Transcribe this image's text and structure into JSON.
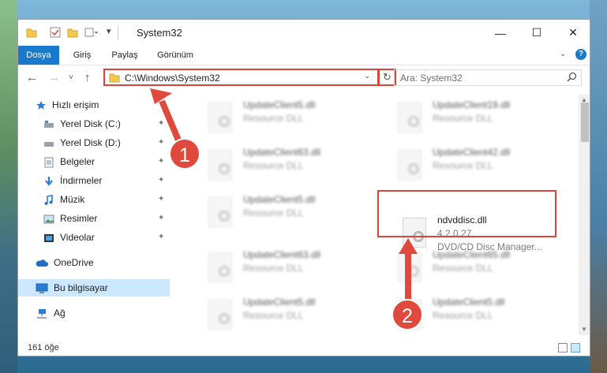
{
  "window": {
    "title": "System32",
    "controls": {
      "minimize": "—",
      "maximize": "☐",
      "close": "✕"
    }
  },
  "ribbon": {
    "tabs": [
      "Dosya",
      "Giriş",
      "Paylaş",
      "Görünüm"
    ],
    "active_tab": "Dosya",
    "expand_icon": "chevron-down-icon",
    "help_icon": "?"
  },
  "nav": {
    "address": "C:\\Windows\\System32",
    "search_placeholder": "Ara: System32",
    "refresh": "↻",
    "back": "←",
    "forward": "→",
    "recent": "˅",
    "up": "↑"
  },
  "sidebar": {
    "items": [
      {
        "label": "Hızlı erişim",
        "icon": "star-icon",
        "pinned": false
      },
      {
        "label": "Yerel Disk (C:)",
        "icon": "drive-icon",
        "pinned": true
      },
      {
        "label": "Yerel Disk (D:)",
        "icon": "drive-icon",
        "pinned": true
      },
      {
        "label": "Belgeler",
        "icon": "documents-icon",
        "pinned": true
      },
      {
        "label": "İndirmeler",
        "icon": "downloads-icon",
        "pinned": true
      },
      {
        "label": "Müzik",
        "icon": "music-icon",
        "pinned": true
      },
      {
        "label": "Resimler",
        "icon": "pictures-icon",
        "pinned": true
      },
      {
        "label": "Videolar",
        "icon": "videos-icon",
        "pinned": true
      },
      {
        "label": "OneDrive",
        "icon": "onedrive-icon",
        "pinned": false
      },
      {
        "label": "Bu bilgisayar",
        "icon": "computer-icon",
        "pinned": false,
        "selected": true
      },
      {
        "label": "Ağ",
        "icon": "network-icon",
        "pinned": false
      }
    ],
    "pin_glyph": "📌"
  },
  "files": [
    {
      "name": "UpdateClient5.dll",
      "desc": "Resource DLL"
    },
    {
      "name": "UpdateClient19.dll",
      "desc": "Resource DLL"
    },
    {
      "name": "UpdateClient63.dll",
      "desc": "Resource DLL"
    },
    {
      "name": "UpdateClient42.dll",
      "desc": "Resource DLL"
    },
    {
      "name": "UpdateClient5.dll",
      "desc": "Resource DLL"
    },
    {
      "name": "ndvddisc.dll",
      "desc": "4.2.0.27",
      "desc2": "DVD/CD Disc Manager...",
      "highlighted": true
    },
    {
      "name": "UpdateClient63.dll",
      "desc": "Resource DLL"
    },
    {
      "name": "UpdateClient65.dll",
      "desc": "Resource DLL"
    },
    {
      "name": "UpdateClient5.dll",
      "desc": "Resource DLL"
    },
    {
      "name": "UpdateClient5.dll",
      "desc": "Resource DLL"
    }
  ],
  "status": {
    "count": "161 öğe"
  },
  "annotations": {
    "step1": "1",
    "step2": "2"
  },
  "colors": {
    "accent": "#1979ca",
    "highlight": "#d9443a",
    "selected": "#cce8ff"
  }
}
